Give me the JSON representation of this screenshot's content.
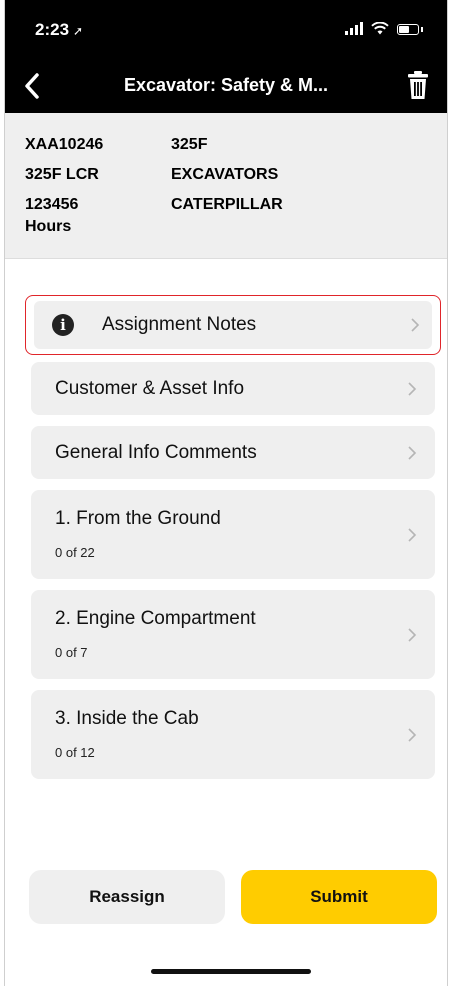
{
  "status_bar": {
    "time": "2:23",
    "location_glyph": "➚"
  },
  "nav": {
    "title": "Excavator: Safety & M...",
    "back_icon": "chevron-left-icon",
    "delete_icon": "trash-icon"
  },
  "asset": {
    "serial": "XAA10246",
    "model": "325F",
    "config": "325F LCR",
    "family": "EXCAVATORS",
    "hours_value": "123456",
    "hours_label": "Hours",
    "make": "CATERPILLAR"
  },
  "sections": [
    {
      "label": "Assignment Notes",
      "icon": "info-icon"
    },
    {
      "label": "Customer & Asset Info"
    },
    {
      "label": "General Info Comments"
    },
    {
      "label": "1. From the Ground",
      "progress": "0 of 22"
    },
    {
      "label": "2. Engine Compartment",
      "progress": "0 of 7"
    },
    {
      "label": "3. Inside the Cab",
      "progress": "0 of 12"
    }
  ],
  "actions": {
    "reassign": "Reassign",
    "submit": "Submit"
  },
  "colors": {
    "accent": "#ffcc00",
    "highlight": "#e0252a",
    "card": "#efefef",
    "header": "#000000"
  }
}
